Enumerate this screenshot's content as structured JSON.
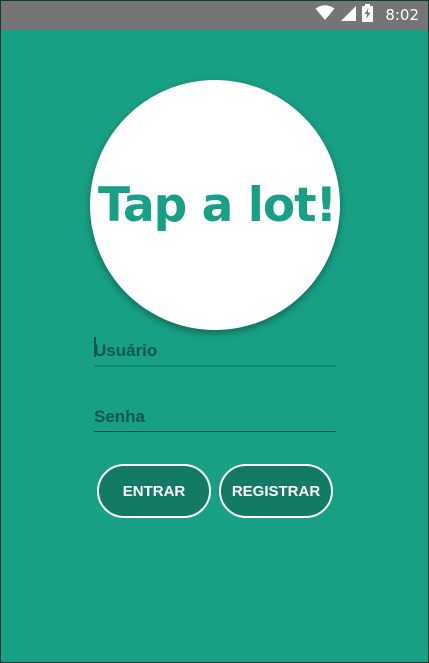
{
  "status_bar": {
    "time": "8:02",
    "icons": [
      "wifi-icon",
      "signal-icon",
      "battery-charging-icon"
    ]
  },
  "logo": {
    "text": "Tap a lot!"
  },
  "form": {
    "username_placeholder": "Usuário",
    "password_placeholder": "Senha"
  },
  "buttons": {
    "enter_label": "ENTRAR",
    "register_label": "REGISTRAR"
  },
  "colors": {
    "background": "#18a085",
    "status_bar": "#757575",
    "button_fill": "#127a65",
    "field_text": "#10584a"
  }
}
